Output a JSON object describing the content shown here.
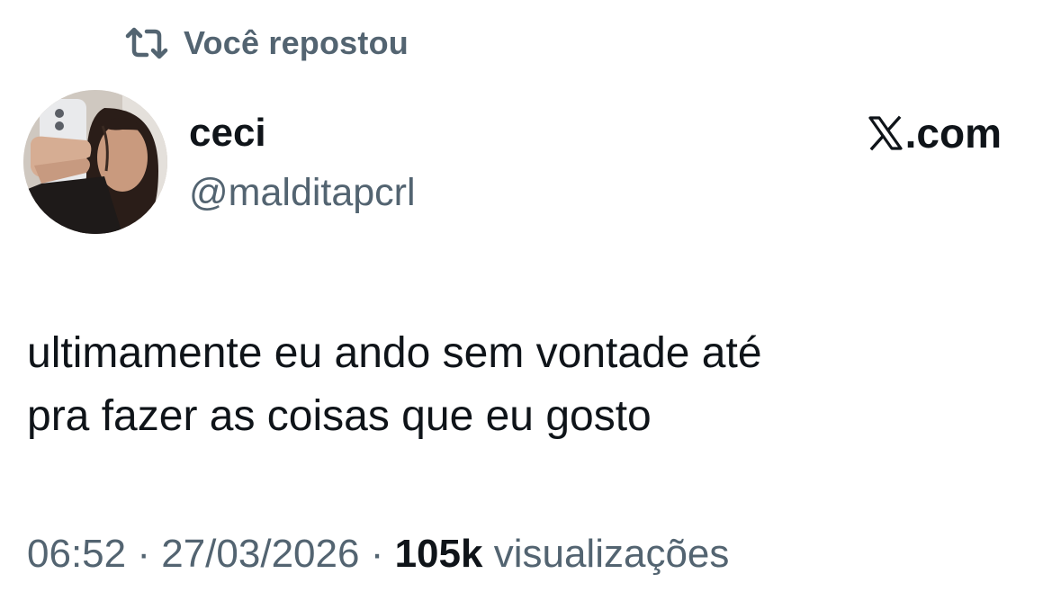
{
  "repost": {
    "label": "Você repostou",
    "icon": "repost-icon"
  },
  "author": {
    "display_name": "ceci",
    "handle": "@malditapcrl",
    "avatar": "profile-photo"
  },
  "brand": {
    "text": ".com",
    "icon": "x-logo-icon"
  },
  "tweet": {
    "lines": [
      "ultimamente eu ando sem vontade até",
      "pra fazer as coisas que eu gosto"
    ]
  },
  "meta": {
    "time": "06:52",
    "separator": "·",
    "date": "27/03/2026",
    "views_count": "105k",
    "views_label": "visualizações"
  },
  "colors": {
    "text_primary": "#0f1419",
    "text_secondary": "#536471",
    "background": "#ffffff"
  }
}
